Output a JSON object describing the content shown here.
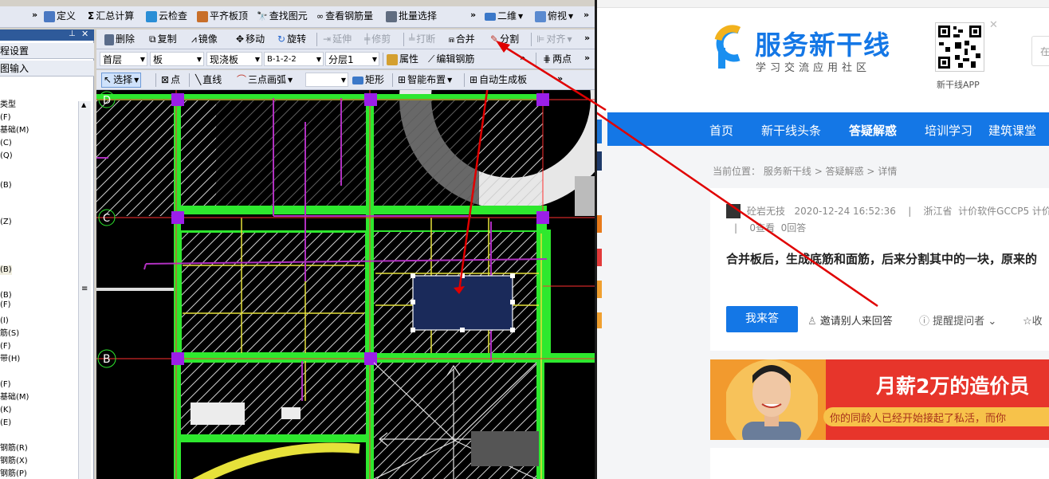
{
  "cad": {
    "toolbar1": {
      "define": "定义",
      "sum_calc": "汇总计算",
      "cloud_check": "云检查",
      "flat_top": "平齐板顶",
      "find_element": "查找图元",
      "view_rebar": "查看钢筋量",
      "batch_select": "批量选择",
      "view_2d": "二维",
      "view_top": "俯视"
    },
    "toolbar2": {
      "delete": "删除",
      "copy": "复制",
      "mirror": "镜像",
      "move": "移动",
      "rotate": "旋转",
      "extend": "延伸",
      "trim": "修剪",
      "break": "打断",
      "merge": "合并",
      "split": "分割",
      "align": "对齐"
    },
    "toolbar3": {
      "floor": "首层",
      "type": "板",
      "subtype": "现浇板",
      "name": "B-1-2-2",
      "layer": "分层1",
      "props": "属性",
      "edit_rebar": "编辑钢筋",
      "two_points": "两点"
    },
    "toolbar4": {
      "select": "选择",
      "point": "点",
      "line": "直线",
      "arc3": "三点画弧",
      "rect": "矩形",
      "smart_layout": "智能布置",
      "auto_slab": "自动生成板"
    },
    "left_panel": {
      "btn1": "程设置",
      "btn2": "图输入",
      "tree": [
        "类型",
        "(F)",
        "基础(M)",
        "(C)",
        "(Q)",
        "(B)",
        "(Z)",
        "(B)",
        "(B)",
        "(F)",
        "(I)",
        "筋(S)",
        "(F)",
        "带(H)",
        "(F)",
        "基础(M)",
        "(K)",
        "(E)",
        "钢筋(R)",
        "钢筋(X)",
        "钢筋(P)"
      ]
    },
    "axis": {
      "d": "D",
      "c": "C",
      "b": "B"
    }
  },
  "web": {
    "brand": "服务新干线",
    "slogan": "学习交流应用社区",
    "app_label": "新干线APP",
    "search_hint": "在",
    "nav": [
      "首页",
      "新干线头条",
      "答疑解惑",
      "培训学习",
      "建筑课堂"
    ],
    "breadcrumb": {
      "prefix": "当前位置：",
      "a": "服务新干线",
      "b": "答疑解惑",
      "c": "详情",
      "sep": ">"
    },
    "meta": {
      "user": "砼岩无技",
      "time": "2020-12-24 16:52:36",
      "region": "浙江省",
      "software": "计价软件GCCP5 计价",
      "views": "0查看",
      "answers": "0回答",
      "pipe": "|"
    },
    "question": "合并板后，生成底筋和面筋，后来分割其中的一块，原来的",
    "actions": {
      "answer": "我来答",
      "invite": "邀请别人来回答",
      "remind": "提醒提问者",
      "collect": "收"
    },
    "ad": {
      "title": "月薪2万的造价员",
      "sub": "你的同龄人已经开始接起了私活，而你"
    }
  },
  "colors": {
    "accent": "#1477e6",
    "green": "#2ee82e",
    "magenta": "#b030c0",
    "yellow": "#e6e13a",
    "red_arrow": "#e00000",
    "purple": "#9b1fe8"
  }
}
